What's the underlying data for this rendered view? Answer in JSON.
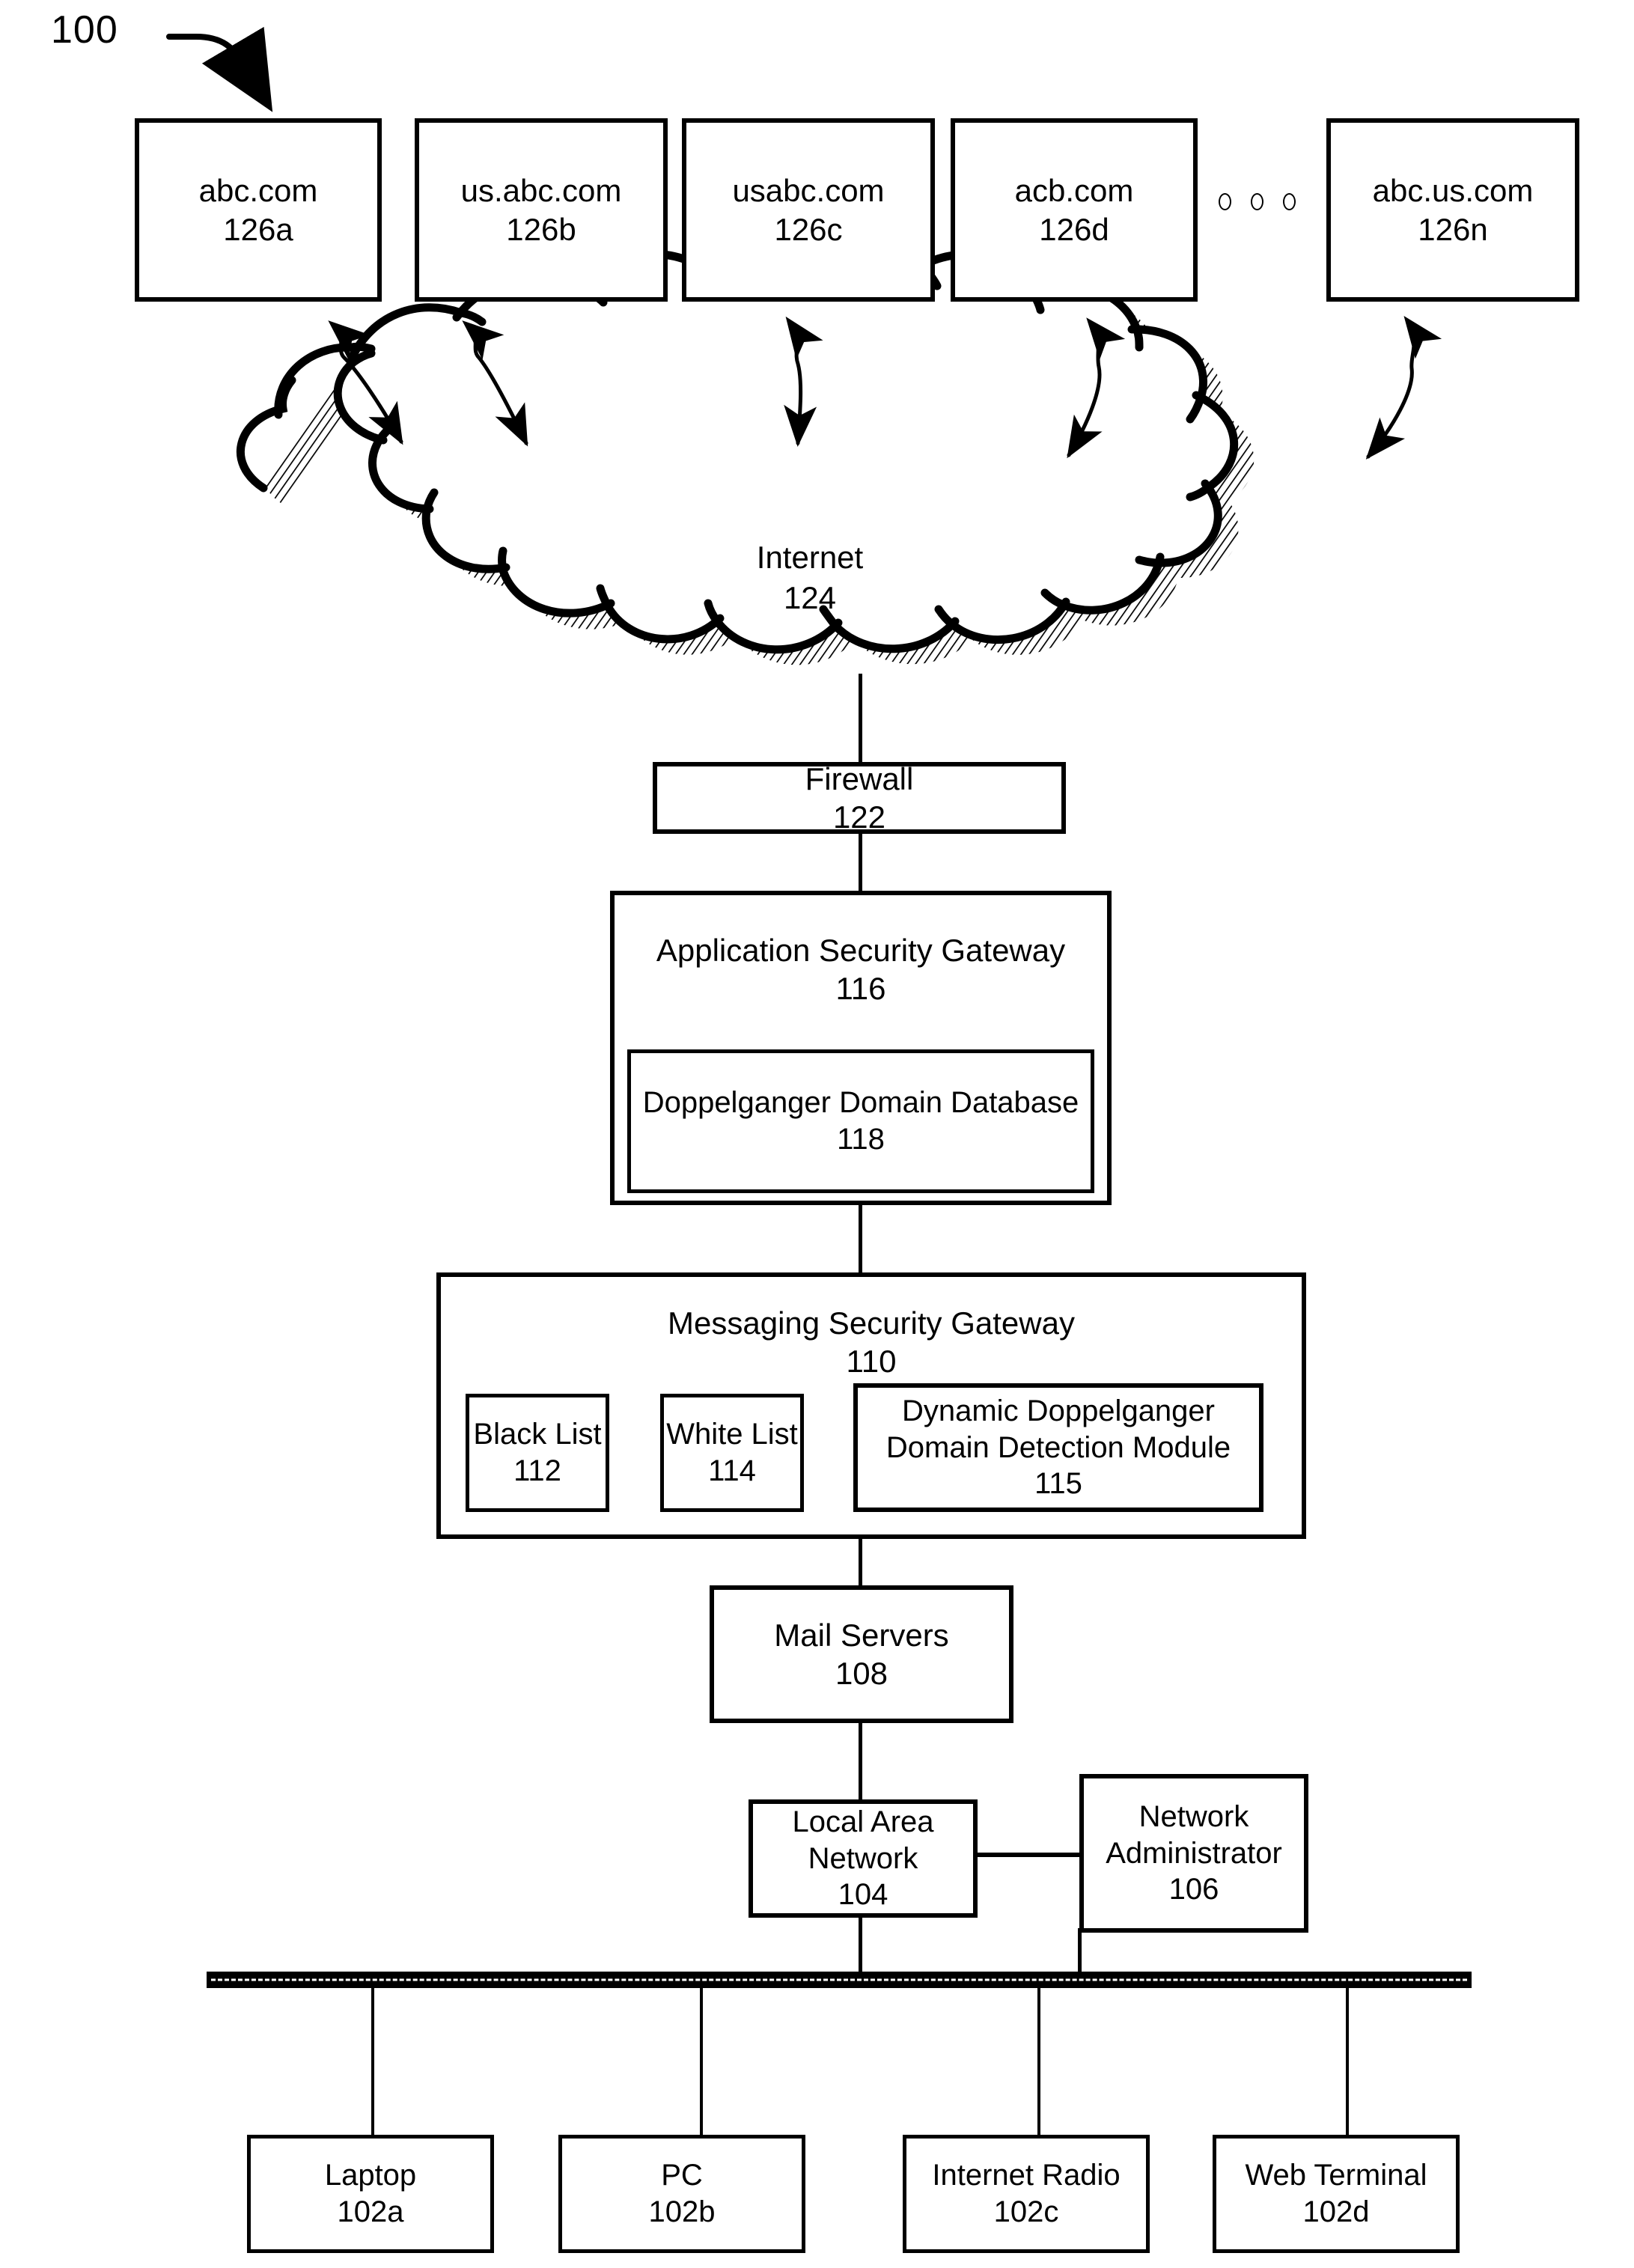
{
  "figure": {
    "reference_numeral": "100"
  },
  "domains": [
    {
      "name": "abc.com",
      "ref": "126a"
    },
    {
      "name": "us.abc.com",
      "ref": "126b"
    },
    {
      "name": "usabc.com",
      "ref": "126c"
    },
    {
      "name": "acb.com",
      "ref": "126d"
    },
    {
      "name": "abc.us.com",
      "ref": "126n"
    }
  ],
  "ellipsis": {
    "dots": 3
  },
  "cloud": {
    "label": "Internet",
    "ref": "124"
  },
  "firewall": {
    "label": "Firewall",
    "ref": "122"
  },
  "application_security_gateway": {
    "label": "Application Security Gateway",
    "ref": "116",
    "child": {
      "label": "Doppelganger Domain Database",
      "ref": "118"
    }
  },
  "messaging_security_gateway": {
    "label": "Messaging Security Gateway",
    "ref": "110",
    "children": [
      {
        "label": "Black List",
        "ref": "112"
      },
      {
        "label": "White List",
        "ref": "114"
      },
      {
        "label": "Dynamic Doppelganger Domain Detection Module",
        "ref": "115"
      }
    ]
  },
  "mail_servers": {
    "label": "Mail Servers",
    "ref": "108"
  },
  "local_area_network": {
    "label": "Local Area Network",
    "ref": "104"
  },
  "network_administrator": {
    "label": "Network Administrator",
    "ref": "106"
  },
  "endpoints": [
    {
      "label": "Laptop",
      "ref": "102a"
    },
    {
      "label": "PC",
      "ref": "102b"
    },
    {
      "label": "Internet Radio",
      "ref": "102c"
    },
    {
      "label": "Web Terminal",
      "ref": "102d"
    }
  ],
  "colors": {
    "stroke": "#000000",
    "background": "#ffffff"
  }
}
